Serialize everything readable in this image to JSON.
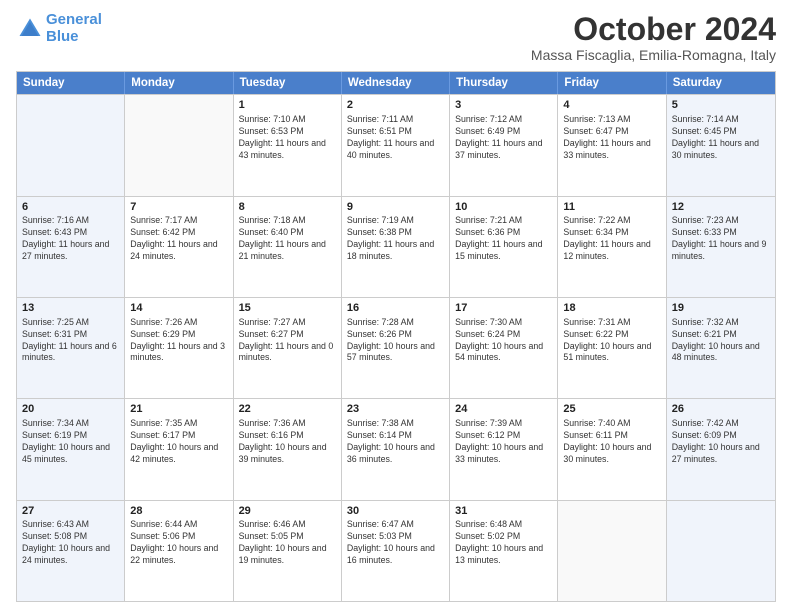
{
  "header": {
    "logo_line1": "General",
    "logo_line2": "Blue",
    "title": "October 2024",
    "subtitle": "Massa Fiscaglia, Emilia-Romagna, Italy"
  },
  "days_of_week": [
    "Sunday",
    "Monday",
    "Tuesday",
    "Wednesday",
    "Thursday",
    "Friday",
    "Saturday"
  ],
  "weeks": [
    [
      {
        "day": "",
        "text": "",
        "shaded": true
      },
      {
        "day": "",
        "text": "",
        "shaded": false
      },
      {
        "day": "1",
        "text": "Sunrise: 7:10 AM\nSunset: 6:53 PM\nDaylight: 11 hours and 43 minutes.",
        "shaded": false
      },
      {
        "day": "2",
        "text": "Sunrise: 7:11 AM\nSunset: 6:51 PM\nDaylight: 11 hours and 40 minutes.",
        "shaded": false
      },
      {
        "day": "3",
        "text": "Sunrise: 7:12 AM\nSunset: 6:49 PM\nDaylight: 11 hours and 37 minutes.",
        "shaded": false
      },
      {
        "day": "4",
        "text": "Sunrise: 7:13 AM\nSunset: 6:47 PM\nDaylight: 11 hours and 33 minutes.",
        "shaded": false
      },
      {
        "day": "5",
        "text": "Sunrise: 7:14 AM\nSunset: 6:45 PM\nDaylight: 11 hours and 30 minutes.",
        "shaded": true
      }
    ],
    [
      {
        "day": "6",
        "text": "Sunrise: 7:16 AM\nSunset: 6:43 PM\nDaylight: 11 hours and 27 minutes.",
        "shaded": true
      },
      {
        "day": "7",
        "text": "Sunrise: 7:17 AM\nSunset: 6:42 PM\nDaylight: 11 hours and 24 minutes.",
        "shaded": false
      },
      {
        "day": "8",
        "text": "Sunrise: 7:18 AM\nSunset: 6:40 PM\nDaylight: 11 hours and 21 minutes.",
        "shaded": false
      },
      {
        "day": "9",
        "text": "Sunrise: 7:19 AM\nSunset: 6:38 PM\nDaylight: 11 hours and 18 minutes.",
        "shaded": false
      },
      {
        "day": "10",
        "text": "Sunrise: 7:21 AM\nSunset: 6:36 PM\nDaylight: 11 hours and 15 minutes.",
        "shaded": false
      },
      {
        "day": "11",
        "text": "Sunrise: 7:22 AM\nSunset: 6:34 PM\nDaylight: 11 hours and 12 minutes.",
        "shaded": false
      },
      {
        "day": "12",
        "text": "Sunrise: 7:23 AM\nSunset: 6:33 PM\nDaylight: 11 hours and 9 minutes.",
        "shaded": true
      }
    ],
    [
      {
        "day": "13",
        "text": "Sunrise: 7:25 AM\nSunset: 6:31 PM\nDaylight: 11 hours and 6 minutes.",
        "shaded": true
      },
      {
        "day": "14",
        "text": "Sunrise: 7:26 AM\nSunset: 6:29 PM\nDaylight: 11 hours and 3 minutes.",
        "shaded": false
      },
      {
        "day": "15",
        "text": "Sunrise: 7:27 AM\nSunset: 6:27 PM\nDaylight: 11 hours and 0 minutes.",
        "shaded": false
      },
      {
        "day": "16",
        "text": "Sunrise: 7:28 AM\nSunset: 6:26 PM\nDaylight: 10 hours and 57 minutes.",
        "shaded": false
      },
      {
        "day": "17",
        "text": "Sunrise: 7:30 AM\nSunset: 6:24 PM\nDaylight: 10 hours and 54 minutes.",
        "shaded": false
      },
      {
        "day": "18",
        "text": "Sunrise: 7:31 AM\nSunset: 6:22 PM\nDaylight: 10 hours and 51 minutes.",
        "shaded": false
      },
      {
        "day": "19",
        "text": "Sunrise: 7:32 AM\nSunset: 6:21 PM\nDaylight: 10 hours and 48 minutes.",
        "shaded": true
      }
    ],
    [
      {
        "day": "20",
        "text": "Sunrise: 7:34 AM\nSunset: 6:19 PM\nDaylight: 10 hours and 45 minutes.",
        "shaded": true
      },
      {
        "day": "21",
        "text": "Sunrise: 7:35 AM\nSunset: 6:17 PM\nDaylight: 10 hours and 42 minutes.",
        "shaded": false
      },
      {
        "day": "22",
        "text": "Sunrise: 7:36 AM\nSunset: 6:16 PM\nDaylight: 10 hours and 39 minutes.",
        "shaded": false
      },
      {
        "day": "23",
        "text": "Sunrise: 7:38 AM\nSunset: 6:14 PM\nDaylight: 10 hours and 36 minutes.",
        "shaded": false
      },
      {
        "day": "24",
        "text": "Sunrise: 7:39 AM\nSunset: 6:12 PM\nDaylight: 10 hours and 33 minutes.",
        "shaded": false
      },
      {
        "day": "25",
        "text": "Sunrise: 7:40 AM\nSunset: 6:11 PM\nDaylight: 10 hours and 30 minutes.",
        "shaded": false
      },
      {
        "day": "26",
        "text": "Sunrise: 7:42 AM\nSunset: 6:09 PM\nDaylight: 10 hours and 27 minutes.",
        "shaded": true
      }
    ],
    [
      {
        "day": "27",
        "text": "Sunrise: 6:43 AM\nSunset: 5:08 PM\nDaylight: 10 hours and 24 minutes.",
        "shaded": true
      },
      {
        "day": "28",
        "text": "Sunrise: 6:44 AM\nSunset: 5:06 PM\nDaylight: 10 hours and 22 minutes.",
        "shaded": false
      },
      {
        "day": "29",
        "text": "Sunrise: 6:46 AM\nSunset: 5:05 PM\nDaylight: 10 hours and 19 minutes.",
        "shaded": false
      },
      {
        "day": "30",
        "text": "Sunrise: 6:47 AM\nSunset: 5:03 PM\nDaylight: 10 hours and 16 minutes.",
        "shaded": false
      },
      {
        "day": "31",
        "text": "Sunrise: 6:48 AM\nSunset: 5:02 PM\nDaylight: 10 hours and 13 minutes.",
        "shaded": false
      },
      {
        "day": "",
        "text": "",
        "shaded": false
      },
      {
        "day": "",
        "text": "",
        "shaded": true
      }
    ]
  ]
}
